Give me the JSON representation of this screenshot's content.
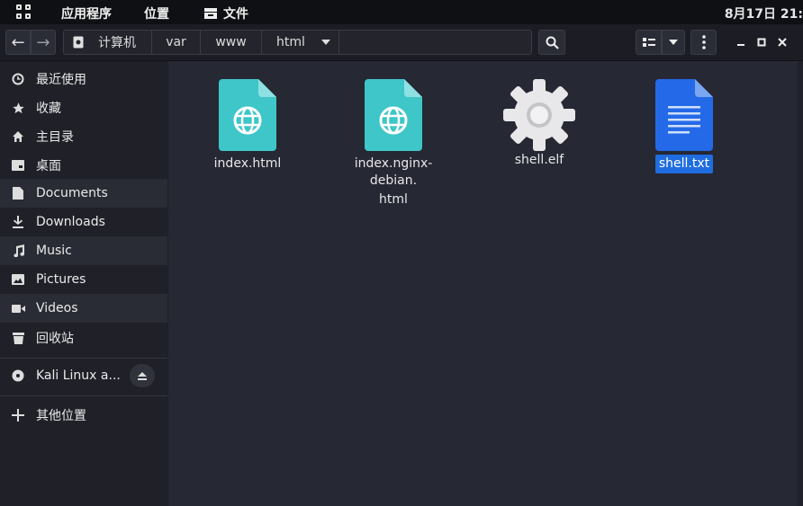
{
  "topbar": {
    "apps": "应用程序",
    "places": "位置",
    "files": "文件",
    "clock": "8月17日 21:"
  },
  "toolbar": {
    "back": "←",
    "forward": "→",
    "path": [
      "计算机",
      "var",
      "www",
      "html"
    ]
  },
  "sidebar": {
    "items": [
      {
        "label": "最近使用",
        "icon": "clock-icon"
      },
      {
        "label": "收藏",
        "icon": "star-icon"
      },
      {
        "label": "主目录",
        "icon": "home-icon"
      },
      {
        "label": "桌面",
        "icon": "desktop-icon"
      },
      {
        "label": "Documents",
        "icon": "document-icon"
      },
      {
        "label": "Downloads",
        "icon": "download-icon"
      },
      {
        "label": "Music",
        "icon": "music-icon"
      },
      {
        "label": "Pictures",
        "icon": "picture-icon"
      },
      {
        "label": "Videos",
        "icon": "video-icon"
      },
      {
        "label": "回收站",
        "icon": "trash-icon"
      },
      {
        "label": "Kali Linux a...",
        "icon": "disc-icon"
      },
      {
        "label": "其他位置",
        "icon": "plus-icon"
      }
    ]
  },
  "files": [
    {
      "name": "index.html",
      "icon": "web-file-icon"
    },
    {
      "name": "index.nginx-debian.html",
      "line1": "index.nginx-debian.",
      "line2": "html",
      "icon": "web-file-icon"
    },
    {
      "name": "shell.elf",
      "icon": "gear-icon"
    },
    {
      "name": "shell.txt",
      "icon": "text-file-icon",
      "selected": true
    }
  ],
  "colors": {
    "accent": "#1f6de0",
    "web_file": "#3ec6c9",
    "text_file": "#2469e8"
  }
}
